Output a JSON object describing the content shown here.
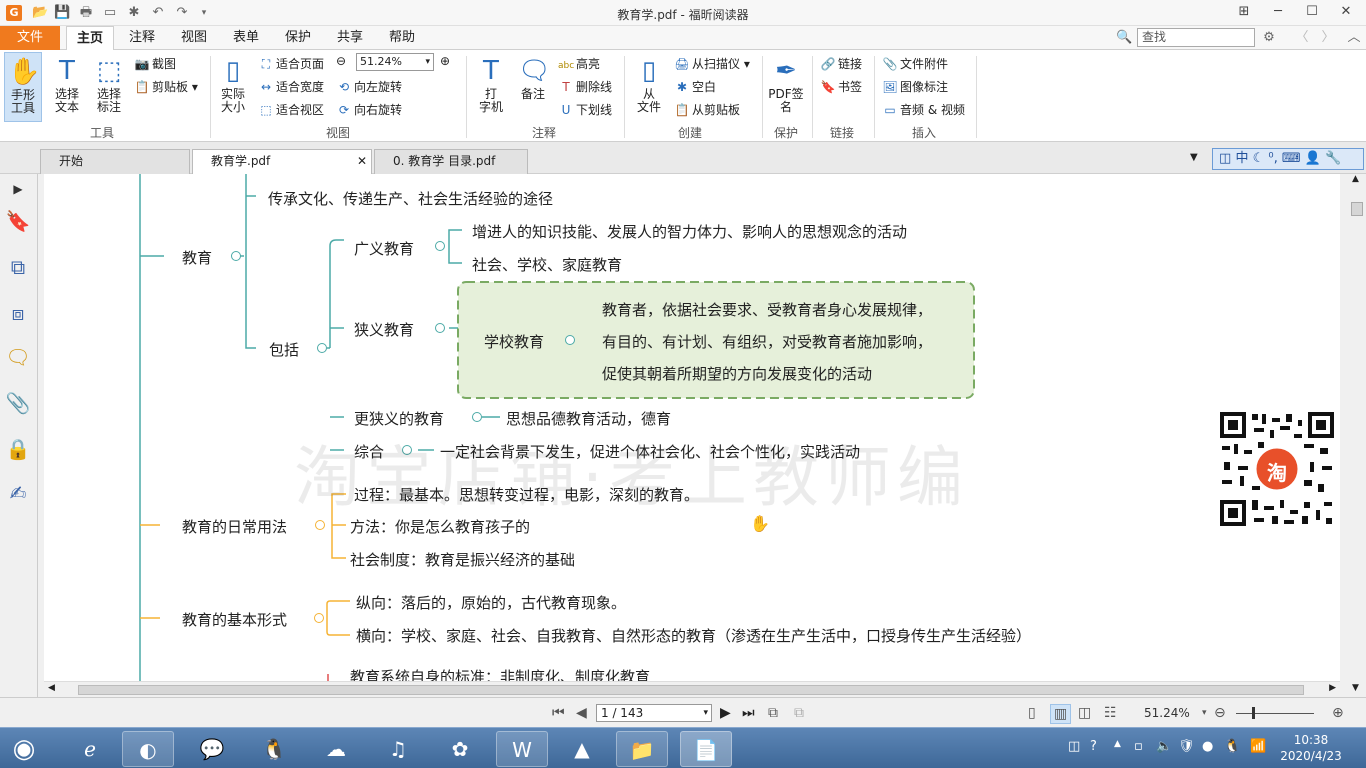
{
  "window": {
    "title": "教育学.pdf - 福昕阅读器"
  },
  "menubar": {
    "file": "文件",
    "tabs": [
      "主页",
      "注释",
      "视图",
      "表单",
      "保护",
      "共享",
      "帮助"
    ],
    "search_placeholder": "查找"
  },
  "ribbon": {
    "hand_tool": "手形\n工具",
    "select_text": "选择\n文本",
    "select_annot": "选择\n标注",
    "screenshot": "截图",
    "clipboard": "剪贴板",
    "actual_size": "实际\n大小",
    "fit_page": "适合页面",
    "fit_width": "适合宽度",
    "fit_visible": "适合视区",
    "zoom_value": "51.24%",
    "rotate_left": "向左旋转",
    "rotate_right": "向右旋转",
    "typewriter": "打\n字机",
    "note": "备注",
    "highlight": "高亮",
    "strikeout": "删除线",
    "underline": "下划线",
    "from_file": "从\n文件",
    "from_scanner": "从扫描仪",
    "blank": "空白",
    "from_clipboard": "从剪贴板",
    "pdf_sign": "PDF签\n名",
    "link": "链接",
    "bookmark": "书签",
    "file_attachment": "文件附件",
    "image_annotation": "图像标注",
    "audio_video": "音频 & 视频",
    "groups": {
      "tools": "工具",
      "view": "视图",
      "comment": "注释",
      "create": "创建",
      "protect": "保护",
      "links": "链接",
      "insert": "插入"
    }
  },
  "doc_tabs": [
    "开始",
    "教育学.pdf",
    "0. 教育学 目录.pdf"
  ],
  "ime_bar": "中",
  "mindmap": {
    "top_line": "传承文化、传递生产、社会生活经验的途径",
    "education": "教育",
    "include": "包括",
    "broad": "广义教育",
    "broad_1": "增进人的知识技能、发展人的智力体力、影响人的思想观念的活动",
    "broad_2": "社会、学校、家庭教育",
    "narrow": "狭义教育",
    "school": "学校教育",
    "school_1": "教育者，依据社会要求、受教育者身心发展规律，",
    "school_2": "有目的、有计划、有组织，对受教育者施加影响，",
    "school_3": "促使其朝着所期望的方向发展变化的活动",
    "narrower": "更狭义的教育",
    "narrower_1": "思想品德教育活动，德育",
    "combined": "综合",
    "combined_1": "一定社会背景下发生，促进个体社会化、社会个性化，实践活动",
    "daily": "教育的日常用法",
    "daily_1": "过程：最基本。思想转变过程，电影，深刻的教育。",
    "daily_2": "方法：你是怎么教育孩子的",
    "daily_3": "社会制度：教育是振兴经济的基础",
    "basic": "教育的基本形式",
    "basic_1": "纵向：落后的，原始的，古代教育现象。",
    "basic_2": "横向：学校、家庭、社会、自我教育、自然形态的教育（渗透在生产生活中，口授身传生产生活经验）",
    "cut_off": "教育系统自身的标准：非制度化、制度化教育",
    "watermark": "淘宝店铺·考上教师编",
    "qr_badge": "淘"
  },
  "status": {
    "page": "1 / 143",
    "zoom": "51.24%"
  },
  "clock": {
    "time": "10:38",
    "date": "2020/4/23"
  }
}
